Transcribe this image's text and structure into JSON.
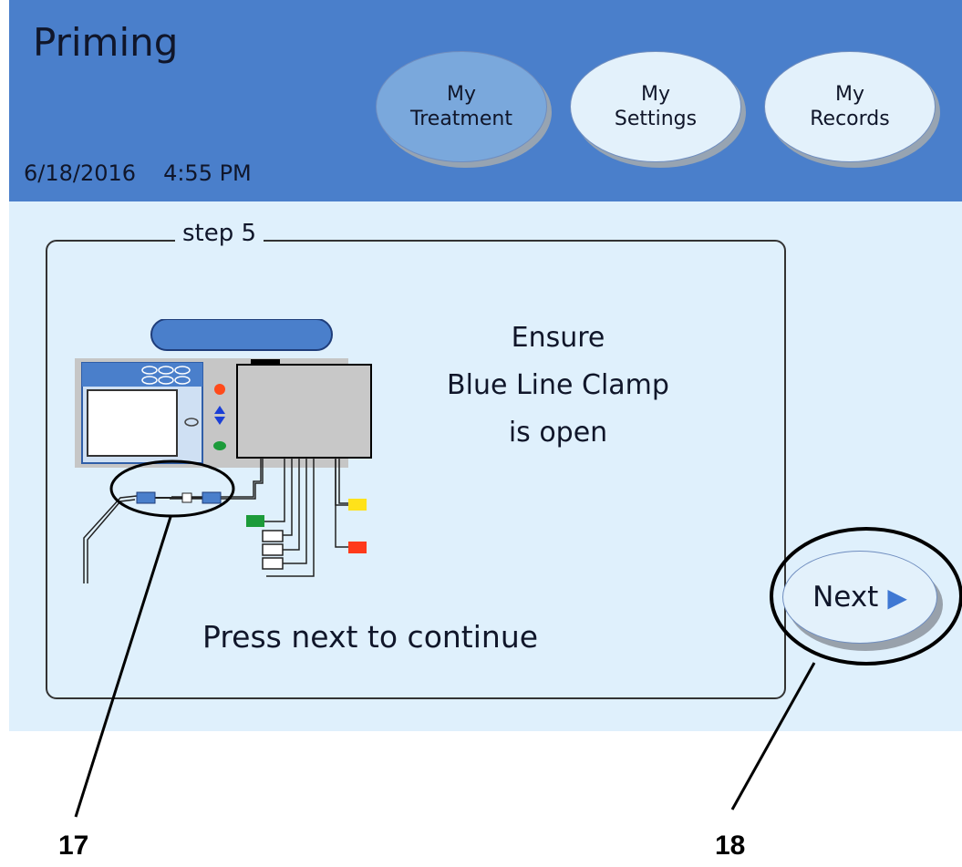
{
  "header": {
    "title": "Priming",
    "date": "6/18/2016",
    "time": "4:55 PM",
    "nav": [
      {
        "line1": "My",
        "line2": "Treatment",
        "active": true
      },
      {
        "line1": "My",
        "line2": "Settings",
        "active": false
      },
      {
        "line1": "My",
        "line2": "Records",
        "active": false
      }
    ]
  },
  "step": {
    "label": "step 5",
    "instruction": [
      "Ensure",
      "Blue Line Clamp",
      "is open"
    ],
    "prompt": "Press next to continue"
  },
  "next_button": {
    "label": "Next",
    "icon": "play-triangle-icon"
  },
  "callouts": {
    "left": "17",
    "right": "18"
  },
  "colors": {
    "header_bg": "#4a7fcb",
    "content_bg": "#dff0fc",
    "active_tab": "#7aa8dc",
    "accent_blue": "#3f78d3"
  }
}
